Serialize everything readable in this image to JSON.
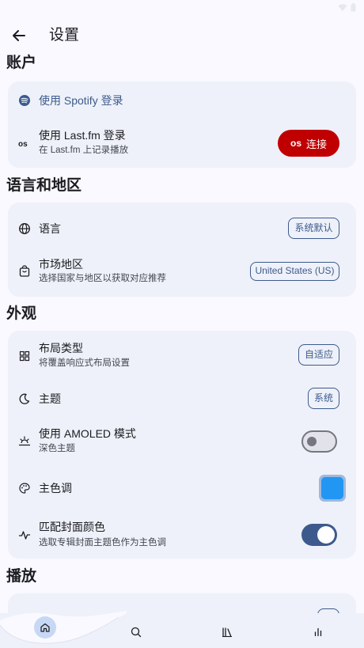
{
  "colors": {
    "accent": "#3d5a8c",
    "card_bg": "#eef1f9",
    "page_bg": "#f9f9ff",
    "connect_button": "#c00000",
    "primary_swatch": "#2196f3"
  },
  "header": {
    "back_icon": "arrow-left-icon",
    "title": "设置"
  },
  "sections": {
    "account": {
      "heading": "账户",
      "spotify": {
        "icon": "spotify-icon",
        "label": "使用 Spotify 登录"
      },
      "lastfm": {
        "icon": "lastfm-icon",
        "label": "使用 Last.fm 登录",
        "subtitle": "在 Last.fm 上记录播放",
        "button_icon_text": "os",
        "button_label": "连接"
      }
    },
    "region": {
      "heading": "语言和地区",
      "language": {
        "icon": "globe-icon",
        "label": "语言",
        "value": "系统默认"
      },
      "market": {
        "icon": "store-icon",
        "label": "市场地区",
        "subtitle": "选择国家与地区以获取对应推荐",
        "value": "United States (US)"
      }
    },
    "appearance": {
      "heading": "外观",
      "layout": {
        "icon": "grid-icon",
        "label": "布局类型",
        "subtitle": "将覆盖响应式布局设置",
        "value": "自适应"
      },
      "theme": {
        "icon": "moon-icon",
        "label": "主题",
        "value": "系统"
      },
      "amoled": {
        "icon": "sunset-icon",
        "label": "使用 AMOLED 模式",
        "subtitle": "深色主题",
        "enabled": false
      },
      "primary_color": {
        "icon": "palette-icon",
        "label": "主色调",
        "value_color": "#2196f3"
      },
      "match_cover": {
        "icon": "pulse-icon",
        "label": "匹配封面颜色",
        "subtitle": "选取专辑封面主题色作为主色调",
        "enabled": true
      }
    },
    "playback": {
      "heading": "播放"
    }
  },
  "bottom_nav": {
    "items": [
      {
        "icon": "home-icon",
        "active": true
      },
      {
        "icon": "search-icon",
        "active": false
      },
      {
        "icon": "library-icon",
        "active": false
      },
      {
        "icon": "stats-icon",
        "active": false
      }
    ]
  }
}
